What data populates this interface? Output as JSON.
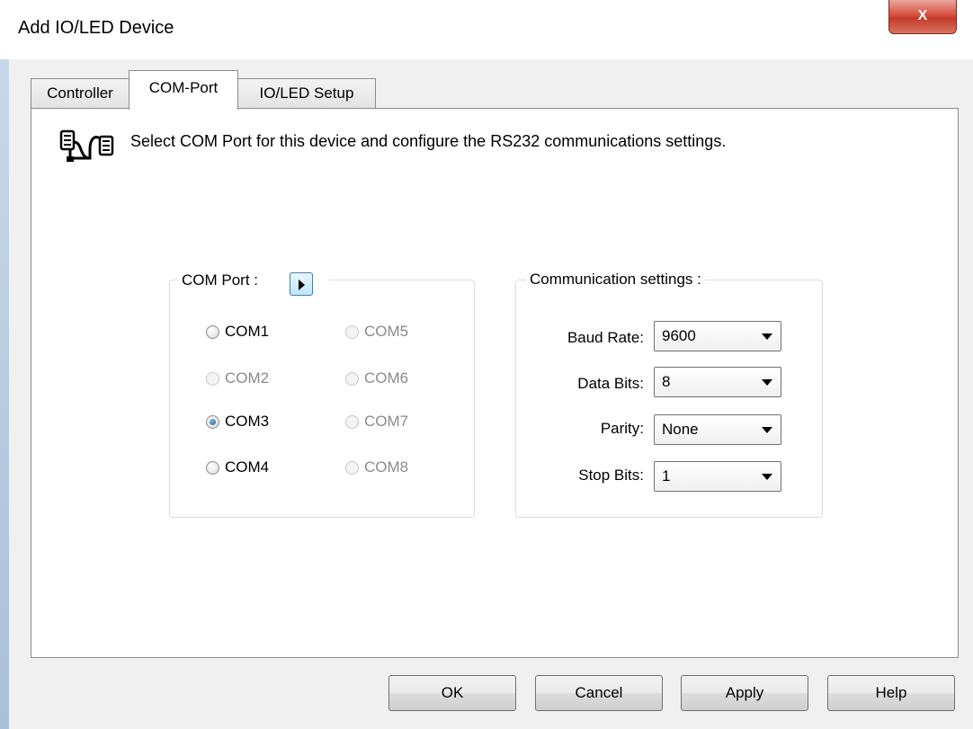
{
  "window": {
    "title": "Add IO/LED Device",
    "close_glyph": "X"
  },
  "tabs": [
    {
      "label": "Controller",
      "active": false
    },
    {
      "label": "COM-Port",
      "active": true
    },
    {
      "label": "IO/LED Setup",
      "active": false
    }
  ],
  "header": {
    "icon": "serial-port-icon",
    "text": "Select COM Port for this device and configure the RS232 communications settings."
  },
  "com_port_group": {
    "legend": "COM Port :",
    "selected": "COM3",
    "ports": [
      {
        "label": "COM1",
        "enabled": true,
        "checked": false
      },
      {
        "label": "COM2",
        "enabled": false,
        "checked": false
      },
      {
        "label": "COM3",
        "enabled": true,
        "checked": true
      },
      {
        "label": "COM4",
        "enabled": true,
        "checked": false
      },
      {
        "label": "COM5",
        "enabled": false,
        "checked": false
      },
      {
        "label": "COM6",
        "enabled": false,
        "checked": false
      },
      {
        "label": "COM7",
        "enabled": false,
        "checked": false
      },
      {
        "label": "COM8",
        "enabled": false,
        "checked": false
      }
    ]
  },
  "comm_settings": {
    "legend": "Communication settings :",
    "baud_rate": {
      "label": "Baud Rate:",
      "value": "9600"
    },
    "data_bits": {
      "label": "Data Bits:",
      "value": "8"
    },
    "parity": {
      "label": "Parity:",
      "value": "None"
    },
    "stop_bits": {
      "label": "Stop Bits:",
      "value": "1"
    }
  },
  "buttons": {
    "ok": "OK",
    "cancel": "Cancel",
    "apply": "Apply",
    "help": "Help"
  },
  "colors": {
    "close_button": "#c43a2a",
    "radio_checked": "#1d5fa8",
    "panel_bg": "#f0f0f0"
  }
}
